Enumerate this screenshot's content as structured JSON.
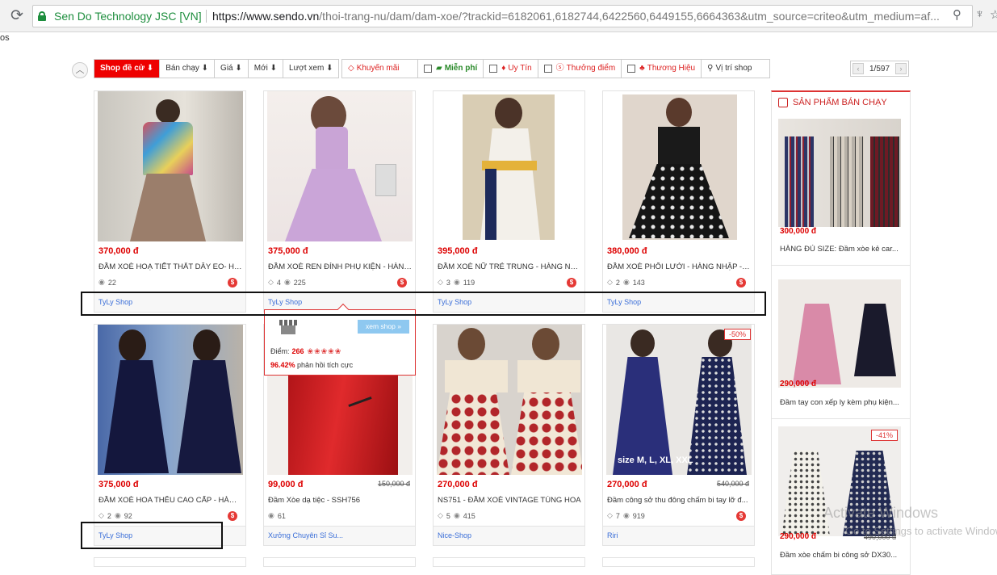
{
  "browser": {
    "site_name": "Sen Do Technology JSC [VN]",
    "url_main": "https://www.sendo.vn",
    "url_rest": "/thoi-trang-nu/dam/dam-xoe/?trackid=6182061,6182744,6422560,6449155,6664363&utm_source=criteo&utm_medium=af...",
    "bookmark_fragment": "os"
  },
  "sort": {
    "items": [
      "Shop đề cử ⬇",
      "Bán chạy ⬇",
      "Giá ⬇",
      "Mới ⬇",
      "Lượt xem ⬇"
    ]
  },
  "filters": {
    "promo": "Khuyến mãi",
    "free_ship": "Miễn phí",
    "trusted": "Uy Tín",
    "reward": "Thưởng điểm",
    "brand": "Thương Hiệu",
    "location": "Vị trí shop"
  },
  "pager": {
    "label": "1/597"
  },
  "products": [
    {
      "price": "370,000 đ",
      "old_price": "",
      "title": "ĐẦM XOÈ HOẠ TIẾT THẮT DÂY EO- HÀ...",
      "tags": "",
      "views": "22",
      "shop": "TyLy Shop",
      "badge": ""
    },
    {
      "price": "375,000 đ",
      "old_price": "",
      "title": "ĐẦM XOÈ REN ĐÍNH PHỤ KIỆN - HÀNG ...",
      "tags": "4",
      "views": "225",
      "shop": "TyLy Shop",
      "badge": ""
    },
    {
      "price": "395,000 đ",
      "old_price": "",
      "title": "ĐẦM XOÈ NỮ TRẺ TRUNG - HÀNG NHẬ...",
      "tags": "3",
      "views": "119",
      "shop": "TyLy Shop",
      "badge": ""
    },
    {
      "price": "380,000 đ",
      "old_price": "",
      "title": "ĐẦM XOÈ PHỐI LƯỚI - HÀNG NHẬP - D...",
      "tags": "2",
      "views": "143",
      "shop": "TyLy Shop",
      "badge": ""
    },
    {
      "price": "375,000 đ",
      "old_price": "",
      "title": "ĐẦM XOÈ HOA THÊU CAO CẤP - HÀNG ...",
      "tags": "2",
      "views": "92",
      "shop": "TyLy Shop",
      "badge": ""
    },
    {
      "price": "99,000 đ",
      "old_price": "150,000 đ",
      "title": "Đầm Xòe dạ tiệc - SSH756",
      "tags": "",
      "views": "61",
      "shop": "Xưởng Chuyên Sỉ Su...",
      "badge": ""
    },
    {
      "price": "270,000 đ",
      "old_price": "",
      "title": "NS751 - ĐẦM XOÈ VINTAGE TÙNG HOA",
      "tags": "5",
      "views": "415",
      "shop": "Nice-Shop",
      "badge": ""
    },
    {
      "price": "270,000 đ",
      "old_price": "540,000 đ",
      "title": "Đầm công sở thu đông chấm bi tay lỡ đ...",
      "tags": "7",
      "views": "919",
      "shop": "Riri",
      "badge": "-50%"
    }
  ],
  "shop_popup": {
    "view_shop": "xem shop »",
    "score_label": "Điểm:",
    "score_value": "266",
    "feedback_pct": "96.42%",
    "feedback_text": "phản hồi tích cực"
  },
  "sidebar": {
    "title": "SẢN PHẨM BÁN CHẠY",
    "items": [
      {
        "price": "300,000 đ",
        "title": "HÀNG ĐỦ SIZE: Đầm xòe kẻ car...",
        "badge": ""
      },
      {
        "price": "290,000 đ",
        "title": "Đầm tay con xếp ly kèm phụ kiện...",
        "badge": ""
      },
      {
        "price": "290,000 đ",
        "old_price": "490,000 đ",
        "title": "Đầm xòe chấm bi công sở DX30...",
        "badge": "-41%"
      }
    ]
  },
  "image_text": {
    "size_label": "size M, L, XL, XXL"
  },
  "watermark": {
    "line1": "Activate Windows",
    "line2": "Go to Settings to activate Windows."
  },
  "colors": {
    "accent": "#dd0000",
    "link": "#3a6ed8",
    "secure": "#1e8e3e"
  }
}
